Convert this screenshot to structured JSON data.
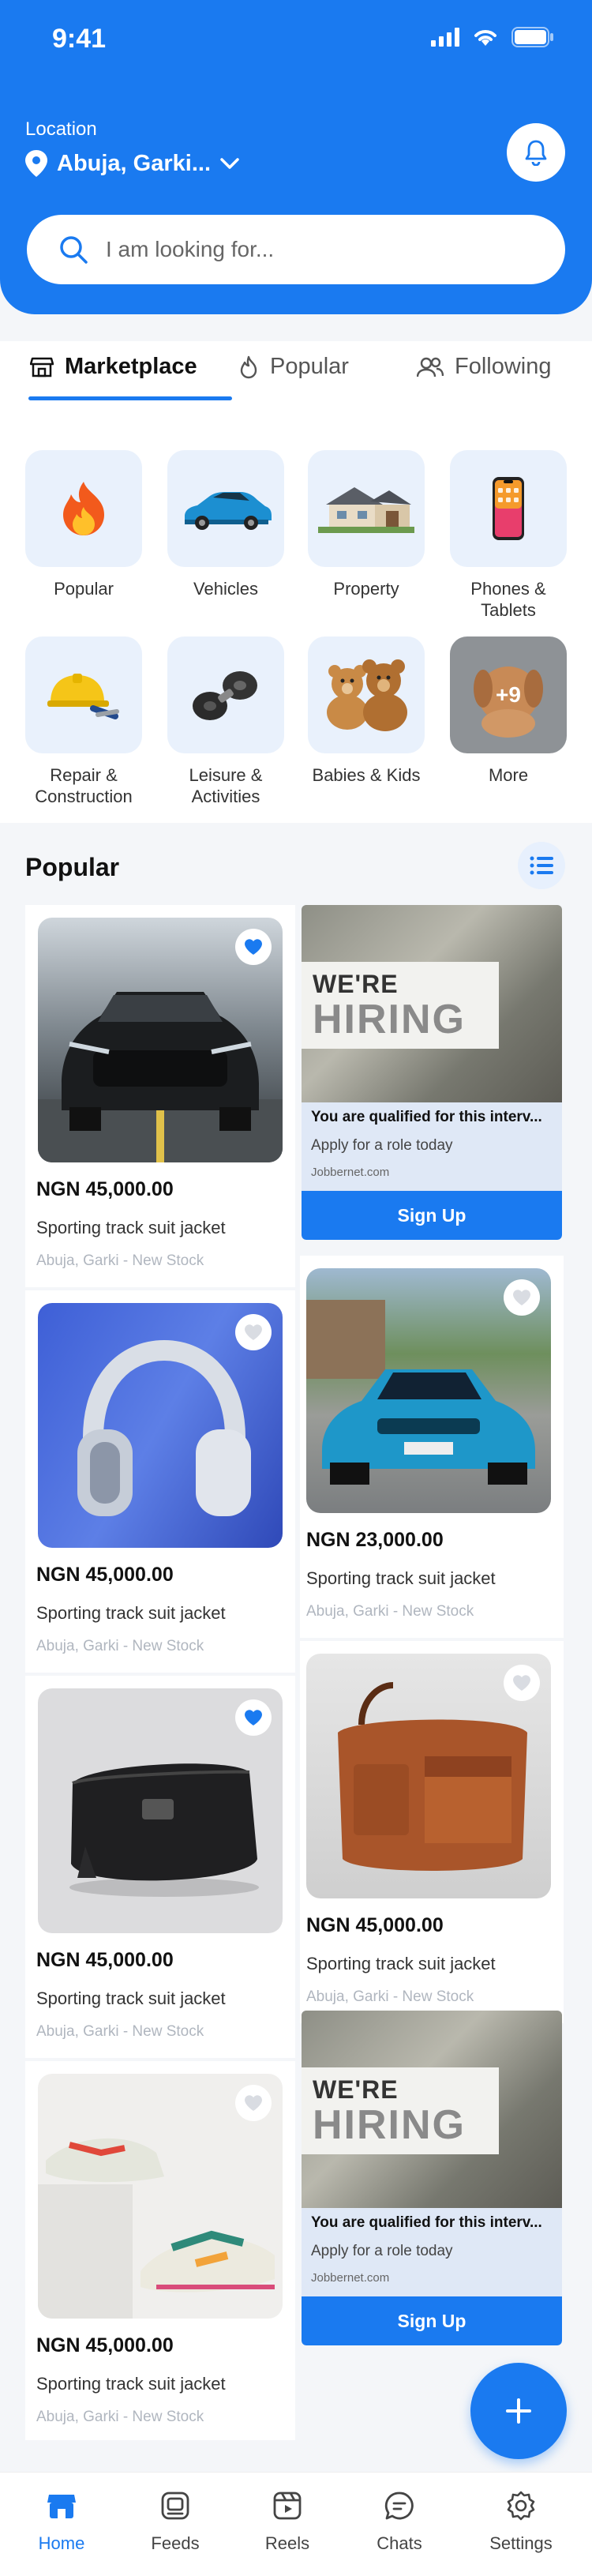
{
  "status": {
    "time": "9:41"
  },
  "location": {
    "label": "Location",
    "value": "Abuja, Garki..."
  },
  "search": {
    "placeholder": "I am looking for..."
  },
  "tabs": [
    {
      "label": "Marketplace",
      "icon": "store-icon",
      "active": true
    },
    {
      "label": "Popular",
      "icon": "flame-icon"
    },
    {
      "label": "Following",
      "icon": "users-icon"
    }
  ],
  "categories": [
    {
      "label": "Popular",
      "icon": "fire-icon"
    },
    {
      "label": "Vehicles",
      "icon": "car-icon"
    },
    {
      "label": "Property",
      "icon": "house-icon"
    },
    {
      "label": "Phones & Tablets",
      "icon": "phone-icon"
    },
    {
      "label": "Repair & Construction",
      "icon": "hardhat-icon"
    },
    {
      "label": "Leisure & Activities",
      "icon": "dumbbell-icon"
    },
    {
      "label": "Babies & Kids",
      "icon": "teddy-bear-icon"
    },
    {
      "label": "More",
      "icon": "puppy-icon",
      "badge": "+9"
    }
  ],
  "popular": {
    "title": "Popular"
  },
  "products": [
    {
      "price": "NGN 45,000.00",
      "name": "Sporting track suit jacket",
      "location": "Abuja, Garki - New Stock",
      "favorited": true,
      "image": "car-front-black"
    },
    {
      "price": "NGN 45,000.00",
      "name": "Sporting track suit jacket",
      "location": "Abuja, Garki - New Stock",
      "favorited": false,
      "image": "headphones-blue"
    },
    {
      "price": "NGN 45,000.00",
      "name": "Sporting track suit jacket",
      "location": "Abuja, Garki - New Stock",
      "favorited": true,
      "image": "leather-pouch-black"
    },
    {
      "price": "NGN 45,000.00",
      "name": "Sporting track suit jacket",
      "location": "Abuja, Garki - New Stock",
      "favorited": false,
      "image": "sneakers-colorful"
    },
    {
      "price": "NGN 23,000.00",
      "name": "Sporting track suit jacket",
      "location": "Abuja, Garki - New Stock",
      "favorited": false,
      "image": "car-blue-bmw"
    },
    {
      "price": "NGN 45,000.00",
      "name": "Sporting track suit jacket",
      "location": "Abuja, Garki - New Stock",
      "favorited": false,
      "image": "leather-bag-brown"
    }
  ],
  "ad": {
    "banner_line1": "WE'RE",
    "banner_line2": "HIRING",
    "title": "You are qualified for this interv...",
    "subtitle": "Apply for a role today",
    "url": "Jobbernet.com",
    "button": "Sign Up"
  },
  "nav": [
    {
      "label": "Home",
      "icon": "home-icon",
      "active": true
    },
    {
      "label": "Feeds",
      "icon": "feeds-icon"
    },
    {
      "label": "Reels",
      "icon": "reels-icon"
    },
    {
      "label": "Chats",
      "icon": "chat-icon"
    },
    {
      "label": "Settings",
      "icon": "settings-icon"
    }
  ],
  "colors": {
    "primary": "#1a7af0",
    "tile": "#e9f1fc",
    "muted": "#b0b6bf"
  }
}
